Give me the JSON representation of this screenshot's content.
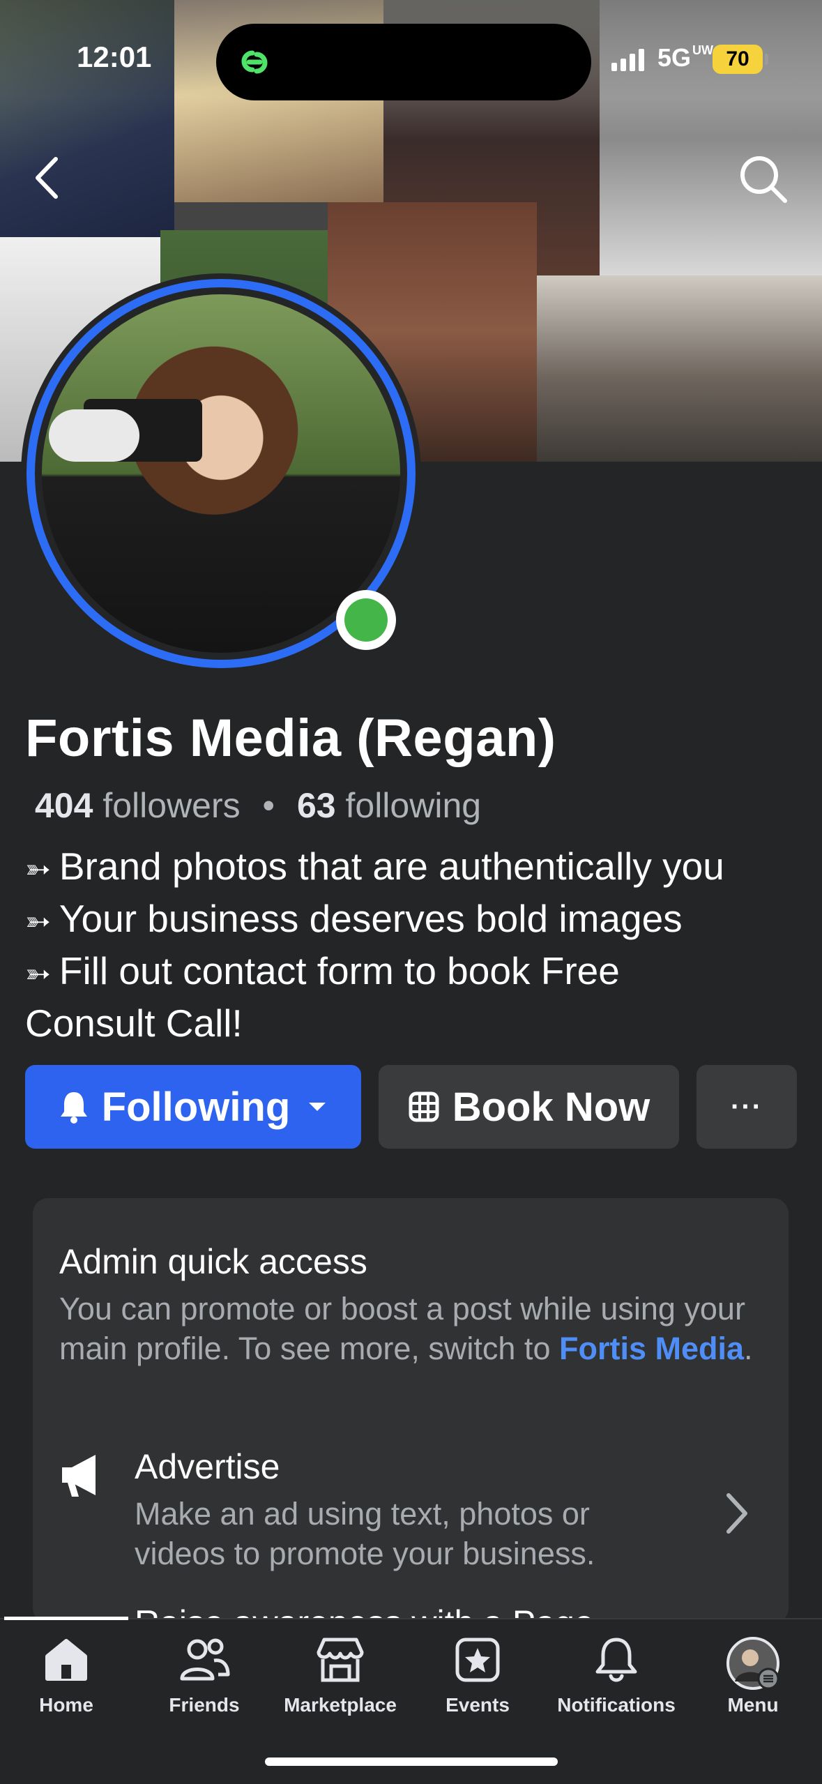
{
  "status_bar": {
    "time": "12:01",
    "network": "5G",
    "network_sup": "UW",
    "battery": "70"
  },
  "profile": {
    "name": "Fortis Media (Regan)",
    "followers_count": "404",
    "followers_label": "followers",
    "separator": "•",
    "following_count": "63",
    "following_label": "following",
    "bio": {
      "marker": "➳",
      "line1": "Brand photos that are authentically you",
      "line2": "Your business deserves bold images",
      "line3": "Fill out contact form to book Free",
      "line4": "Consult Call!"
    }
  },
  "actions": {
    "following": "Following",
    "book_now": "Book Now",
    "more": "···"
  },
  "admin_card": {
    "title": "Admin quick access",
    "desc_prefix": "You can promote or boost a post while using your main profile. To see more, switch to ",
    "link": "Fortis Media",
    "desc_suffix": ".",
    "advertise_title": "Advertise",
    "advertise_desc": "Make an ad using text, photos or videos to promote your business.",
    "next_row_partial": "Raise awareness with a Page..."
  },
  "tabs": [
    {
      "label": "Home",
      "icon": "home-icon"
    },
    {
      "label": "Friends",
      "icon": "friends-icon"
    },
    {
      "label": "Marketplace",
      "icon": "marketplace-icon"
    },
    {
      "label": "Events",
      "icon": "events-icon"
    },
    {
      "label": "Notifications",
      "icon": "bell-icon"
    },
    {
      "label": "Menu",
      "icon": "avatar-menu-icon"
    }
  ],
  "colors": {
    "accent": "#2e63f0",
    "link": "#4f8ef6",
    "online": "#44b549",
    "background": "#242526"
  }
}
